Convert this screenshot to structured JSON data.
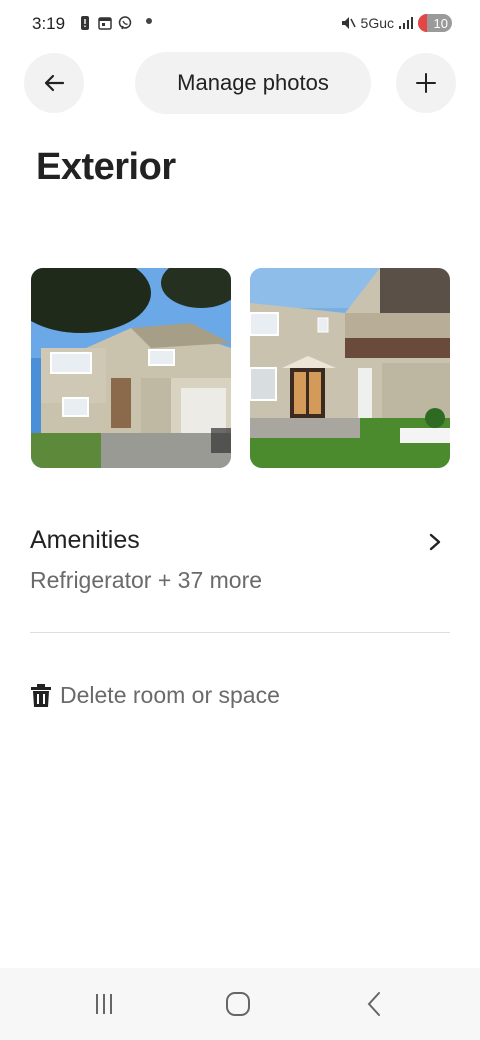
{
  "status_bar": {
    "time": "3:19",
    "network": "5Guc",
    "battery": "10",
    "icons": [
      "alert-icon",
      "calendar-icon",
      "viber-icon",
      "dot-icon",
      "mute-icon",
      "signal-icon"
    ]
  },
  "header": {
    "back_icon": "arrow-left-icon",
    "manage_label": "Manage photos",
    "add_icon": "plus-icon"
  },
  "page": {
    "title": "Exterior"
  },
  "photos": [
    {
      "name": "exterior-photo-front"
    },
    {
      "name": "exterior-photo-back"
    }
  ],
  "amenities": {
    "title": "Amenities",
    "summary": "Refrigerator + 37 more"
  },
  "delete": {
    "label": "Delete room or space"
  },
  "nav": {
    "items": [
      "recent-apps-icon",
      "home-icon",
      "back-icon"
    ]
  },
  "colors": {
    "text": "#222222",
    "muted": "#6a6a6a",
    "button_bg": "#f2f2f2",
    "divider": "#dddddd"
  }
}
